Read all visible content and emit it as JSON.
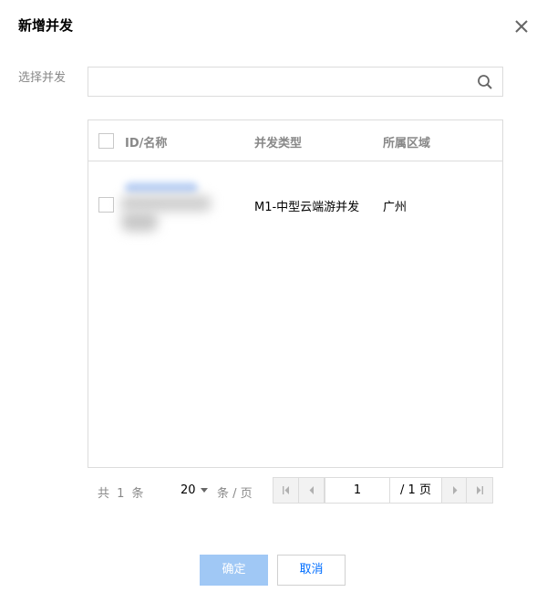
{
  "dialog": {
    "title": "新增并发",
    "close_icon": "close-icon"
  },
  "search": {
    "label": "选择并发",
    "value": "",
    "placeholder": "",
    "icon": "search-icon"
  },
  "table": {
    "columns": [
      "ID/名称",
      "并发类型",
      "所属区域"
    ],
    "rows": [
      {
        "id_name": "",
        "type": "M1-中型云端游并发",
        "region": "广州",
        "checked": false
      }
    ]
  },
  "pagination": {
    "total_text": "共 1 条",
    "page_size": "20",
    "page_size_unit": "条 / 页",
    "current_page": "1",
    "total_pages_text": "/ 1 页"
  },
  "footer": {
    "confirm_label": "确定",
    "cancel_label": "取消"
  },
  "colors": {
    "primary": "#006eff",
    "primary_disabled": "#a0c8f5",
    "border": "#dcdcdc",
    "muted_text": "#888888"
  }
}
